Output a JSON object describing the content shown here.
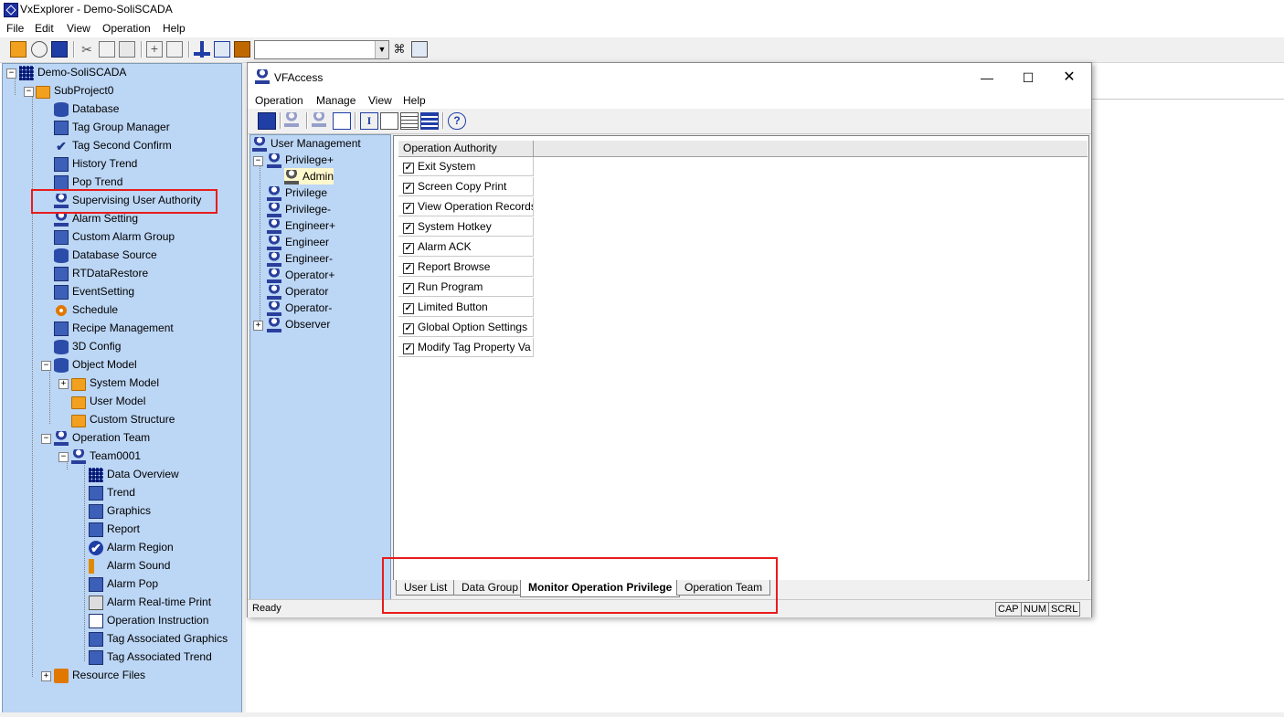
{
  "window": {
    "title": "VxExplorer - Demo-SoliSCADA"
  },
  "menu": [
    "File",
    "Edit",
    "View",
    "Operation",
    "Help"
  ],
  "toolbar": {
    "combo_value": ""
  },
  "tree": {
    "root": "Demo-SoliSCADA",
    "project": "SubProject0",
    "items": [
      "Database",
      "Tag Group Manager",
      "Tag Second Confirm",
      "History Trend",
      "Pop Trend",
      "Supervising User Authority",
      "Alarm Setting",
      "Custom Alarm Group",
      "Database Source",
      "RTDataRestore",
      "EventSetting",
      "Schedule",
      "Recipe Management",
      "3D Config"
    ],
    "object_model": "Object Model",
    "object_model_children": [
      "System Model",
      "User Model",
      "Custom Structure"
    ],
    "operation_team": "Operation Team",
    "team": "Team0001",
    "team_children": [
      "Data Overview",
      "Trend",
      "Graphics",
      "Report",
      "Alarm Region",
      "Alarm Sound",
      "Alarm Pop",
      "Alarm Real-time Print",
      "Operation Instruction",
      "Tag Associated Graphics",
      "Tag Associated Trend"
    ],
    "resource_files": "Resource Files"
  },
  "dialog": {
    "title": "VFAccess",
    "menu": [
      "Operation",
      "Manage",
      "View",
      "Help"
    ],
    "user_tree": {
      "root": "User Management",
      "groups": [
        "Privilege+",
        "Privilege",
        "Privilege-",
        "Engineer+",
        "Engineer",
        "Engineer-",
        "Operator+",
        "Operator",
        "Operator-",
        "Observer"
      ],
      "selected_user": "Admin"
    },
    "grid": {
      "header": "Operation Authority",
      "rows": [
        "Exit System",
        "Screen Copy Print",
        "View Operation Records",
        "System Hotkey",
        "Alarm ACK",
        "Report Browse",
        "Run Program",
        "Limited Button",
        "Global Option Settings",
        "Modify Tag Property Va"
      ],
      "check_mark": "✓"
    },
    "tabs": [
      "User List",
      "Data Group",
      "Monitor Operation Privilege",
      "Operation Team"
    ],
    "active_tab": "Monitor Operation Privilege",
    "status": "Ready",
    "indicators": [
      "CAP",
      "NUM",
      "SCRL"
    ]
  },
  "colors": {
    "tree_bg": "#bcd6f5",
    "highlight": "#e81c1c"
  }
}
